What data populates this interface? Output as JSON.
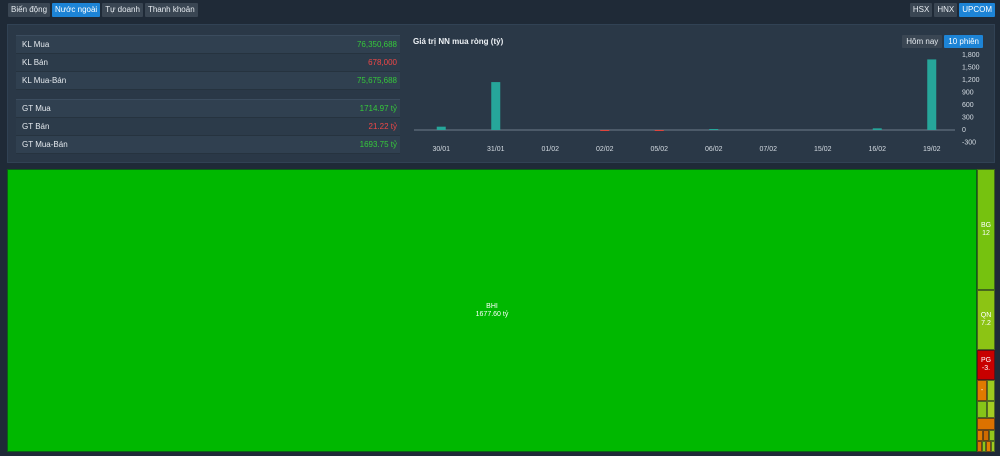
{
  "colors": {
    "accent": "#1d84d6"
  },
  "tabs": {
    "main": [
      {
        "label": "Biến động",
        "active": false
      },
      {
        "label": "Nước ngoài",
        "active": true
      },
      {
        "label": "Tự doanh",
        "active": false
      },
      {
        "label": "Thanh khoản",
        "active": false
      }
    ],
    "exchanges": [
      {
        "label": "HSX",
        "active": false
      },
      {
        "label": "HNX",
        "active": false
      },
      {
        "label": "UPCOM",
        "active": true
      }
    ]
  },
  "summary": {
    "volume_rows": [
      {
        "label": "KL Mua",
        "value": "76,350,688",
        "color": "#35c93a"
      },
      {
        "label": "KL Bán",
        "value": "678,000",
        "color": "#f04747"
      },
      {
        "label": "KL Mua-Bán",
        "value": "75,675,688",
        "color": "#35c93a"
      }
    ],
    "value_rows": [
      {
        "label": "GT Mua",
        "value": "1714.97 tỷ",
        "color": "#35c93a"
      },
      {
        "label": "GT Bán",
        "value": "21.22 tỷ",
        "color": "#f04747"
      },
      {
        "label": "GT Mua-Bán",
        "value": "1693.75 tỷ",
        "color": "#35c93a"
      }
    ]
  },
  "range_buttons": [
    {
      "label": "Hôm nay",
      "active": false
    },
    {
      "label": "10 phiên",
      "active": true
    }
  ],
  "chart_data": {
    "type": "bar",
    "title": "Giá trị NN mua ròng (tỷ)",
    "categories": [
      "30/01",
      "31/01",
      "01/02",
      "02/02",
      "05/02",
      "06/02",
      "07/02",
      "15/02",
      "16/02",
      "19/02"
    ],
    "values": [
      80,
      1150,
      0,
      -12,
      -15,
      15,
      0,
      0,
      40,
      1694
    ],
    "ylim": [
      -300,
      1800
    ],
    "ytick_labels": [
      "1,800",
      "1,500",
      "1,200",
      "900",
      "600",
      "300",
      "0",
      "-300"
    ],
    "y_axis_side": "right",
    "grid": false,
    "positive_color": "#26a69a",
    "negative_color": "#e0443c"
  },
  "treemap": {
    "cells": [
      {
        "code": "BHI",
        "value": "1677.60 tỷ",
        "color": "#00b800"
      },
      {
        "code": "BG",
        "value": "12",
        "color": "#76c20f"
      },
      {
        "code": "QN",
        "value": "7.2",
        "color": "#8cc414"
      },
      {
        "code": "PG",
        "value": "-3.",
        "color": "#c80000"
      },
      {
        "code": "-",
        "color": "#e07a00"
      }
    ],
    "small_cell_colors": [
      "#9cca1e",
      "#86c418",
      "#a3cd22",
      "#dc7200",
      "#e07c00",
      "#cf6a00",
      "#93c71c",
      "#d87400",
      "#8ec61a",
      "#e38000",
      "#9fcb20"
    ]
  }
}
